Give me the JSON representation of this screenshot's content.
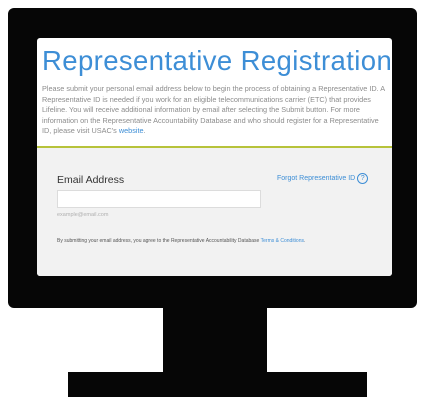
{
  "page": {
    "title": "Representative Registration",
    "intro": {
      "text": "Please submit your personal email address below to begin the process of obtaining a Representative ID. A Representative ID is needed if you work for an eligible telecommunications carrier (ETC) that provides Lifeline. You will receive additional information by email after selecting the Submit button. For more information on the Representative Accountability Database and who should register for a Representative ID, please visit USAC's ",
      "link": "website",
      "end": "."
    }
  },
  "form": {
    "email_label": "Email Address",
    "forgot_link": "Forgot Representative ID",
    "help_icon_glyph": "?",
    "email_value": "",
    "email_hint": "example@email.com",
    "terms_text": "By submitting your email address, you agree to the Representative Accountability Database ",
    "terms_link": "Terms & Conditions",
    "terms_end": "."
  },
  "colors": {
    "title_blue": "#3d8ed6",
    "accent_rule": "#b7c33a",
    "panel_bg": "#f2f2f2",
    "monitor": "#060606"
  }
}
